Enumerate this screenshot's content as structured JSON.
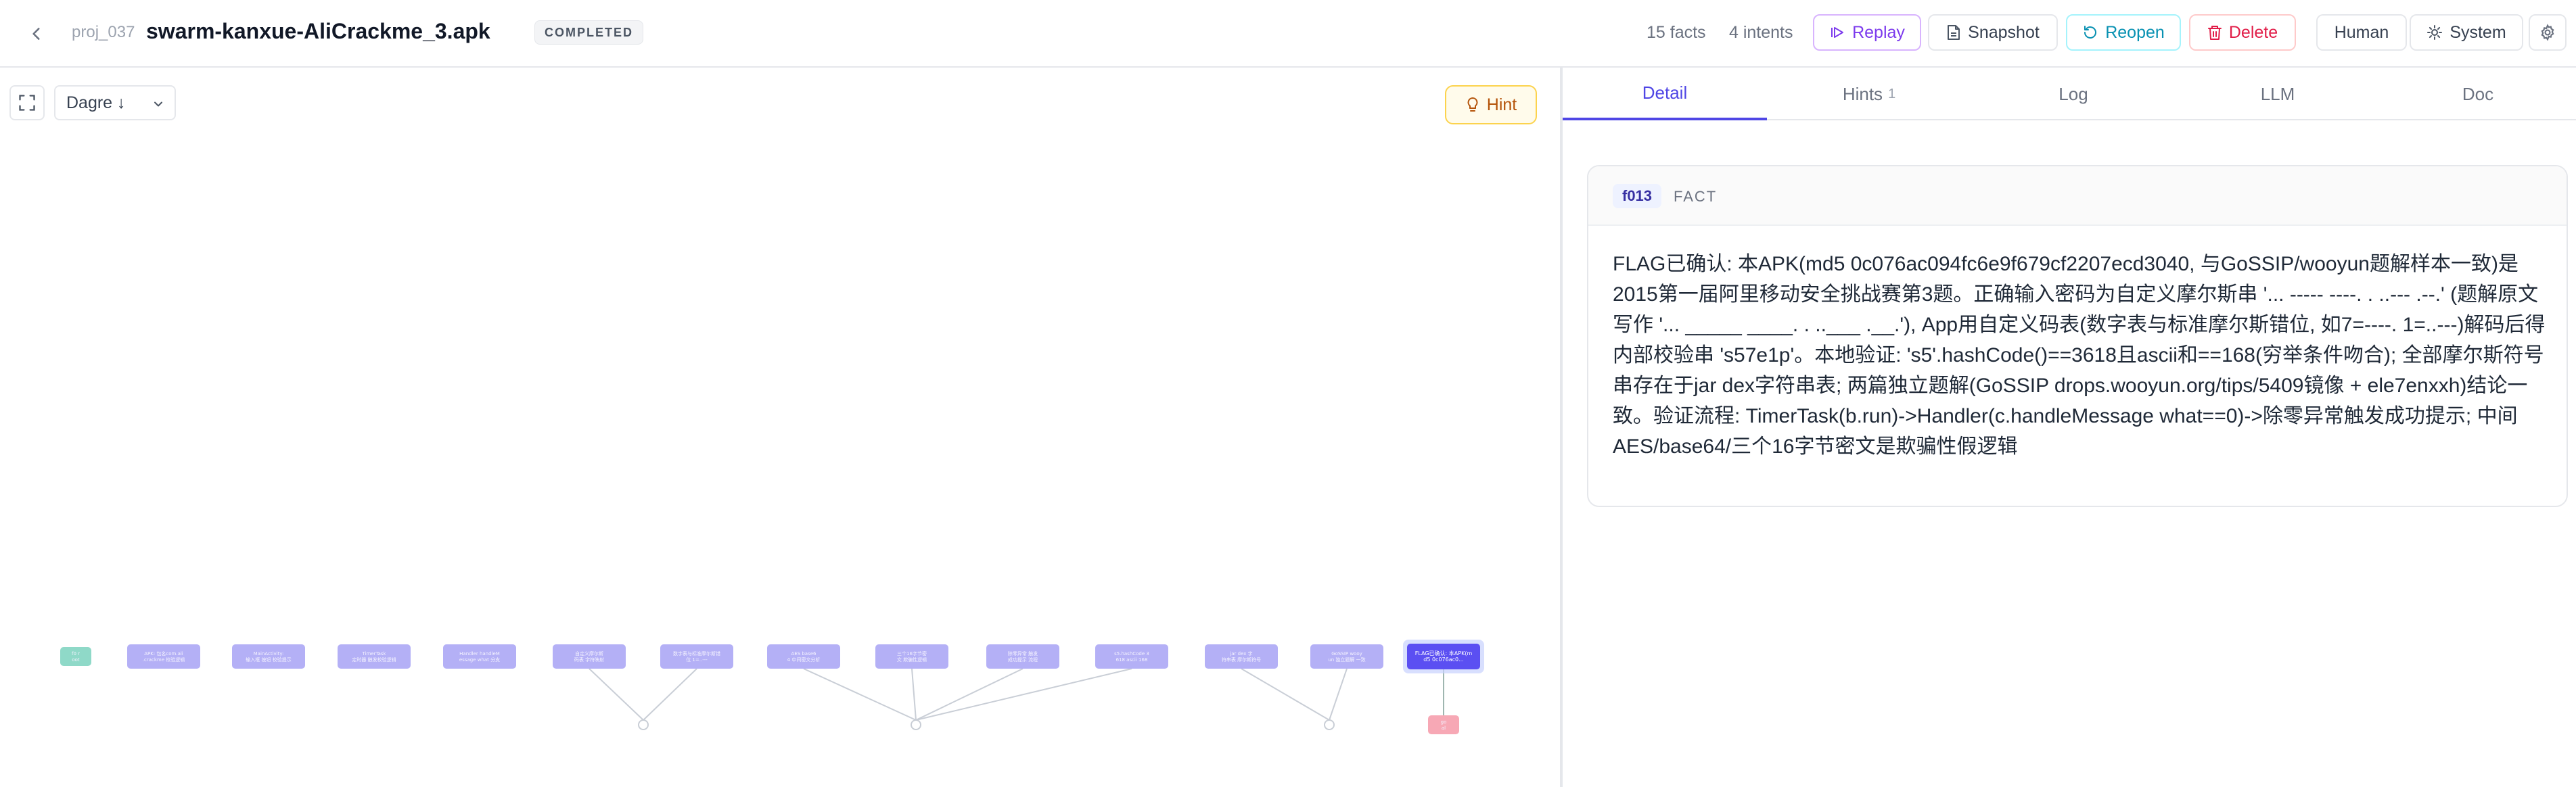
{
  "header": {
    "project_id": "proj_037",
    "title": "swarm-kanxue-AliCrackme_3.apk",
    "status": "COMPLETED",
    "facts_count": "15 facts",
    "intents_count": "4 intents",
    "buttons": {
      "replay": "Replay",
      "snapshot": "Snapshot",
      "reopen": "Reopen",
      "delete": "Delete",
      "human": "Human",
      "system": "System"
    }
  },
  "graph": {
    "layout_value": "Dagre ↓",
    "hint_label": "Hint",
    "nodes": [
      {
        "id": "root",
        "kind": "root",
        "label": "f0 root",
        "row": 0
      },
      {
        "id": "f001",
        "kind": "fact",
        "label": "APK: 包名com.ali.crackme 校验逻辑",
        "row": 0
      },
      {
        "id": "f002",
        "kind": "fact",
        "label": "MainActivity: 输入框 按钮 校验提示",
        "row": 0
      },
      {
        "id": "f003",
        "kind": "fact",
        "label": "TimerTask 定时器 触发校验逻辑",
        "row": 0
      },
      {
        "id": "f004",
        "kind": "fact",
        "label": "Handler handleMessage what 分支",
        "row": 0
      },
      {
        "id": "f005",
        "kind": "fact",
        "label": "自定义摩尔斯 码表 字符映射",
        "row": 0
      },
      {
        "id": "f006",
        "kind": "fact",
        "label": "数字表与标准摩尔斯错位 1=..---",
        "row": 0
      },
      {
        "id": "f007",
        "kind": "fact",
        "label": "AES base64 中间密文分析",
        "row": 0
      },
      {
        "id": "f008",
        "kind": "fact",
        "label": "三个16字节密文 欺骗性逻辑",
        "row": 0
      },
      {
        "id": "f009",
        "kind": "fact",
        "label": "除零异常 触发成功提示 流程",
        "row": 0
      },
      {
        "id": "f010",
        "kind": "fact",
        "label": "s5.hashCode 3618 ascii 168",
        "row": 0
      },
      {
        "id": "f011",
        "kind": "fact",
        "label": "jar dex 字符串表 摩尔斯符号",
        "row": 0
      },
      {
        "id": "f012",
        "kind": "fact",
        "label": "GoSSIP wooyun 独立题解 一致",
        "row": 0
      },
      {
        "id": "f013",
        "kind": "selected",
        "label": "FLAG已确认: 本APK(md5 0c076ac0...",
        "row": 0
      },
      {
        "id": "i1",
        "kind": "intent",
        "label": "",
        "row": 1
      },
      {
        "id": "i2",
        "kind": "intent",
        "label": "",
        "row": 1
      },
      {
        "id": "i3",
        "kind": "intent",
        "label": "",
        "row": 1
      },
      {
        "id": "done",
        "kind": "goal",
        "label": "goal",
        "row": 1
      }
    ]
  },
  "detail_tabs": [
    {
      "label": "Detail",
      "count": ""
    },
    {
      "label": "Hints",
      "count": "1"
    },
    {
      "label": "Log",
      "count": ""
    },
    {
      "label": "LLM",
      "count": ""
    },
    {
      "label": "Doc",
      "count": ""
    }
  ],
  "detail": {
    "fact_id": "f013",
    "fact_type": "FACT",
    "text": "FLAG已确认: 本APK(md5 0c076ac094fc6e9f679cf2207ecd3040, 与GoSSIP/wooyun题解样本一致)是2015第一届阿里移动安全挑战赛第3题。正确输入密码为自定义摩尔斯串 '... ----- ----. . ..--- .--.' (题解原文写作 '... _____ ____. . ..___ .__.'), App用自定义码表(数字表与标准摩尔斯错位, 如7=----. 1=..---)解码后得内部校验串 's57e1p'。本地验证: 's5'.hashCode()==3618且ascii和==168(穷举条件吻合); 全部摩尔斯符号串存在于jar dex字符串表; 两篇独立题解(GoSSIP drops.wooyun.org/tips/5409镜像 + ele7enxxh)结论一致。验证流程: TimerTask(b.run)->Handler(c.handleMessage what==0)->除零异常触发成功提示; 中间AES/base64/三个16字节密文是欺骗性假逻辑"
  },
  "colors": {
    "accent": "#4f46e5",
    "fact_node": "#b4b0f6",
    "selected_node": "#5b4ff2",
    "root_node": "#8fd9c8",
    "goal_node": "#f7a8b5",
    "intent_node": "#e5e7eb"
  }
}
